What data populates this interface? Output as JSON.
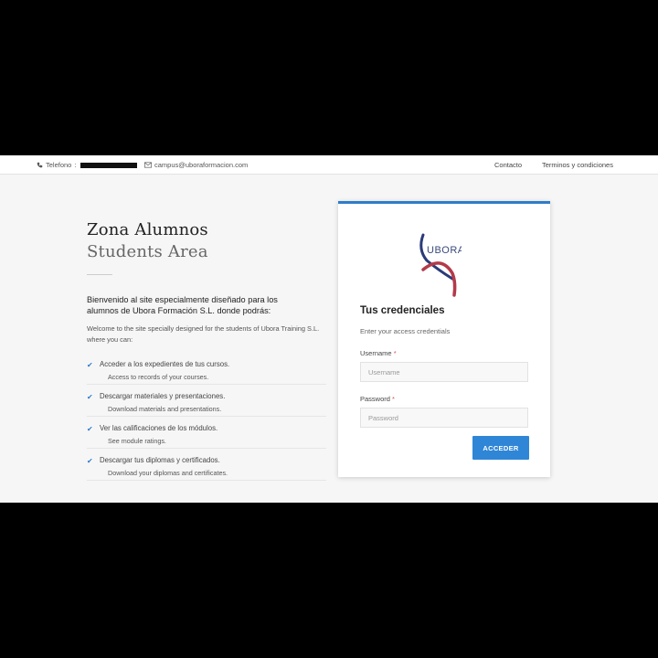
{
  "topbar": {
    "phone_label": "Telefono",
    "email": "campus@uboraformacion.com",
    "nav": [
      "Contacto",
      "Terminos y condiciones"
    ]
  },
  "hero": {
    "title": "Zona Alumnos",
    "subtitle": "Students Area",
    "intro_es": "Bienvenido al site especialmente diseñado para los alumnos de Ubora Formación S.L. donde podrás:",
    "intro_en": "Welcome to the site specially designed for the students of Ubora Training S.L. where you can:",
    "items": [
      {
        "es": "Acceder a los expedientes de tus cursos.",
        "en": "Access to records of your courses."
      },
      {
        "es": "Descargar materiales y presentaciones.",
        "en": "Download materials and presentations."
      },
      {
        "es": "Ver las calificaciones de los módulos.",
        "en": "See module ratings."
      },
      {
        "es": "Descargar tus diplomas y certificados.",
        "en": "Download your diplomas and certificates."
      }
    ]
  },
  "login": {
    "logo_text": "UBORA",
    "heading": "Tus credenciales",
    "subheading": "Enter your access credentials",
    "username_label": "Username",
    "username_placeholder": "Username",
    "password_label": "Password",
    "password_placeholder": "Password",
    "required_mark": "*",
    "submit_label": "ACCEDER"
  },
  "colors": {
    "accent": "#2f86d6",
    "required": "#d9534f",
    "logo_navy": "#2a3b78",
    "logo_red": "#b33a4a"
  }
}
